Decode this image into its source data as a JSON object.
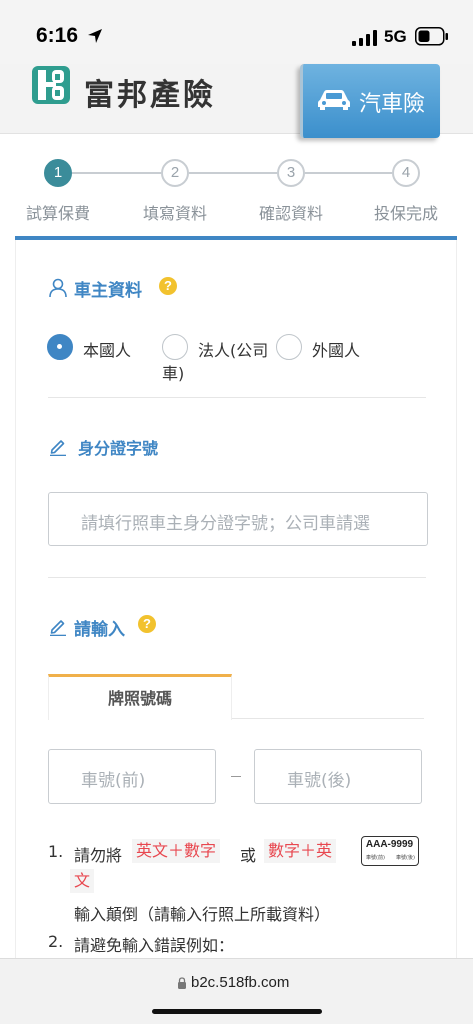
{
  "status_bar": {
    "time": "6:16",
    "network": "5G"
  },
  "header": {
    "brand": "富邦產險",
    "product_tab": "汽車險",
    "accent_color": "#3f86c4"
  },
  "steps": [
    {
      "number": "1",
      "label": "試算保費",
      "active": true
    },
    {
      "number": "2",
      "label": "填寫資料",
      "active": false
    },
    {
      "number": "3",
      "label": "確認資料",
      "active": false
    },
    {
      "number": "4",
      "label": "投保完成",
      "active": false
    }
  ],
  "owner": {
    "title": "車主資料",
    "help": "?",
    "options": {
      "domestic": "本國人",
      "corporate_line1": "法人(公司",
      "corporate_line2": "車)",
      "foreign": "外國人"
    },
    "selected": "本國人"
  },
  "id_section": {
    "title": "身分證字號",
    "placeholder": "請填行照車主身分證字號；公司車請選"
  },
  "plate_section": {
    "title": "請輸入",
    "help": "?",
    "tab_label": "牌照號碼",
    "front_placeholder": "車號(前)",
    "back_placeholder": "車號(後)",
    "separator": "–"
  },
  "notes": {
    "n1_num": "1.",
    "n1_prefix": "請勿將",
    "n1_tag1": "英文＋數字",
    "n1_or": "或",
    "n1_tag2_line1": "數字＋英",
    "n1_tag2_line2": "文",
    "n1_suffix": "輸入顛倒（請輸入行照上所載資料）",
    "n2_num": "2.",
    "n2_text": "請避免輸入錯誤例如：",
    "plate_example": "AAA-9999",
    "plate_front_caption": "車號(前)",
    "plate_back_caption": "車號(後)"
  },
  "browser": {
    "url": "b2c.518fb.com"
  }
}
